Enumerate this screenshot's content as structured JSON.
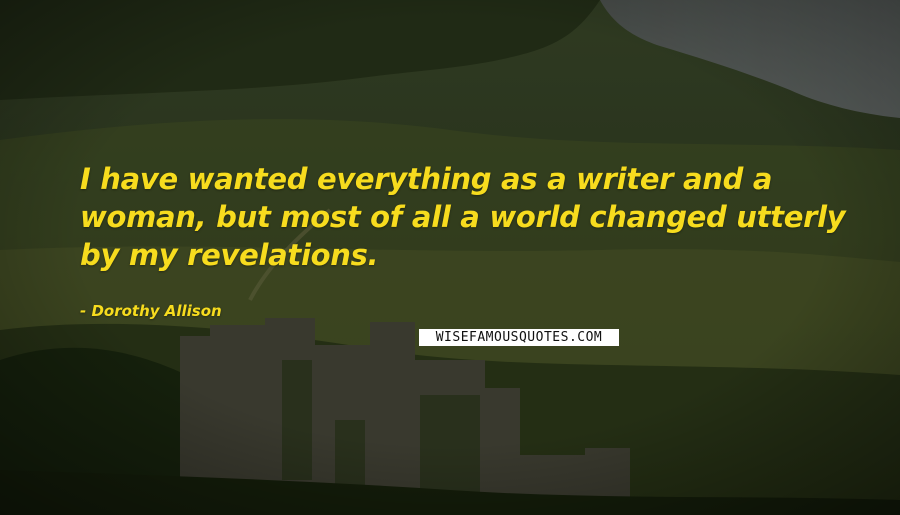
{
  "quote": {
    "text": "I have wanted everything as a writer and a woman, but most of all a world changed utterly by my revelations.",
    "author": "- Dorothy Allison"
  },
  "watermark": {
    "text": "WISEFAMOUSQUOTES.COM"
  },
  "colors": {
    "quote_text": "#f7dc1e",
    "watermark_bg": "#ffffff",
    "watermark_text": "#111111"
  }
}
